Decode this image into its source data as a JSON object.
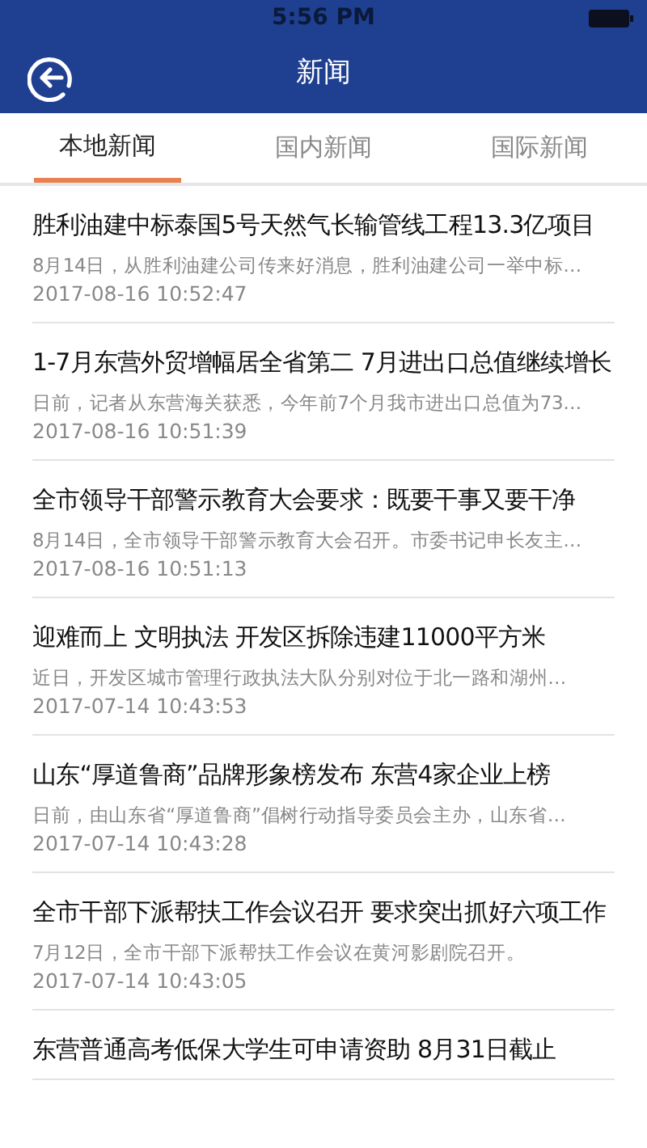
{
  "status_bar": {
    "time": "5:56 PM"
  },
  "nav": {
    "title": "新闻"
  },
  "tabs": [
    {
      "label": "本地新闻",
      "selected": true
    },
    {
      "label": "国内新闻",
      "selected": false
    },
    {
      "label": "国际新闻",
      "selected": false
    }
  ],
  "news": [
    {
      "title": "胜利油建中标泰国5号天然气长输管线工程13.3亿项目",
      "summary": "8月14日，从胜利油建公司传来好消息，胜利油建公司一举中标…",
      "date": "2017-08-16 10:52:47"
    },
    {
      "title": "1-7月东营外贸增幅居全省第二 7月进出口总值继续增长",
      "summary": "日前，记者从东营海关获悉，今年前7个月我市进出口总值为73…",
      "date": "2017-08-16 10:51:39"
    },
    {
      "title": "全市领导干部警示教育大会要求：既要干事又要干净",
      "summary": "8月14日，全市领导干部警示教育大会召开。市委书记申长友主…",
      "date": "2017-08-16 10:51:13"
    },
    {
      "title": "迎难而上 文明执法 开发区拆除违建11000平方米",
      "summary": "近日，开发区城市管理行政执法大队分别对位于北一路和湖州…",
      "date": "2017-07-14 10:43:53"
    },
    {
      "title": "山东“厚道鲁商”品牌形象榜发布 东营4家企业上榜",
      "summary": "日前，由山东省“厚道鲁商”倡树行动指导委员会主办，山东省…",
      "date": "2017-07-14 10:43:28"
    },
    {
      "title": "全市干部下派帮扶工作会议召开 要求突出抓好六项工作",
      "summary": "7月12日，全市干部下派帮扶工作会议在黄河影剧院召开。",
      "date": "2017-07-14 10:43:05"
    },
    {
      "title": "东营普通高考低保大学生可申请资助 8月31日截止"
    }
  ]
}
